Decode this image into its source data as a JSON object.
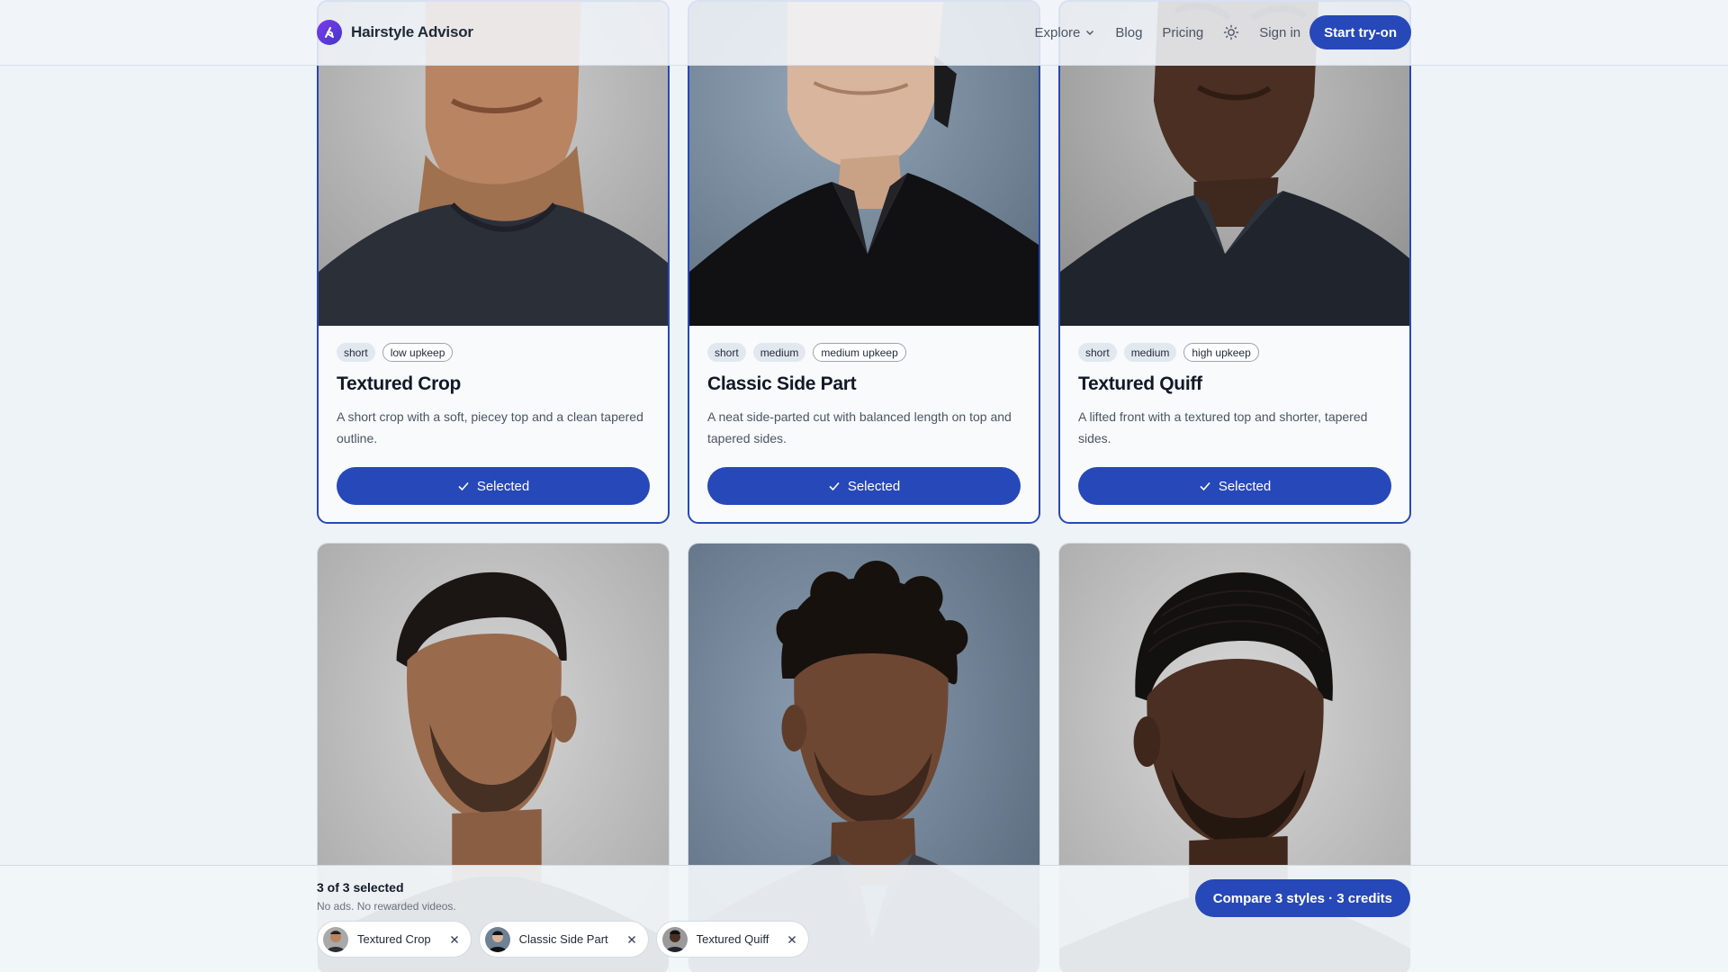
{
  "header": {
    "brand": "Hairstyle Advisor",
    "nav": {
      "explore": "Explore",
      "blog": "Blog",
      "pricing": "Pricing"
    },
    "signin": "Sign in",
    "cta": "Start try-on"
  },
  "cards": [
    {
      "tags": [
        {
          "label": "short",
          "style": "fill"
        },
        {
          "label": "low upkeep",
          "style": "outline"
        }
      ],
      "title": "Textured Crop",
      "description": "A short crop with a soft, piecey top and a clean tapered outline.",
      "button": "Selected"
    },
    {
      "tags": [
        {
          "label": "short",
          "style": "fill"
        },
        {
          "label": "medium",
          "style": "fill"
        },
        {
          "label": "medium upkeep",
          "style": "outline"
        }
      ],
      "title": "Classic Side Part",
      "description": "A neat side-parted cut with balanced length on top and tapered sides.",
      "button": "Selected"
    },
    {
      "tags": [
        {
          "label": "short",
          "style": "fill"
        },
        {
          "label": "medium",
          "style": "fill"
        },
        {
          "label": "high upkeep",
          "style": "outline"
        }
      ],
      "title": "Textured Quiff",
      "description": "A lifted front with a textured top and shorter, tapered sides.",
      "button": "Selected"
    }
  ],
  "bottom_bar": {
    "count": "3 of 3 selected",
    "note": "No ads. No rewarded videos.",
    "chips": [
      {
        "label": "Textured Crop"
      },
      {
        "label": "Classic Side Part"
      },
      {
        "label": "Textured Quiff"
      }
    ],
    "compare": "Compare 3 styles · 3 credits"
  },
  "colors": {
    "accent": "#2748b8",
    "background": "#eef3f8",
    "card": "#f8fafc"
  },
  "icons": [
    "brand-logo-icon",
    "chevron-down-icon",
    "sun-icon",
    "check-icon",
    "close-icon"
  ]
}
